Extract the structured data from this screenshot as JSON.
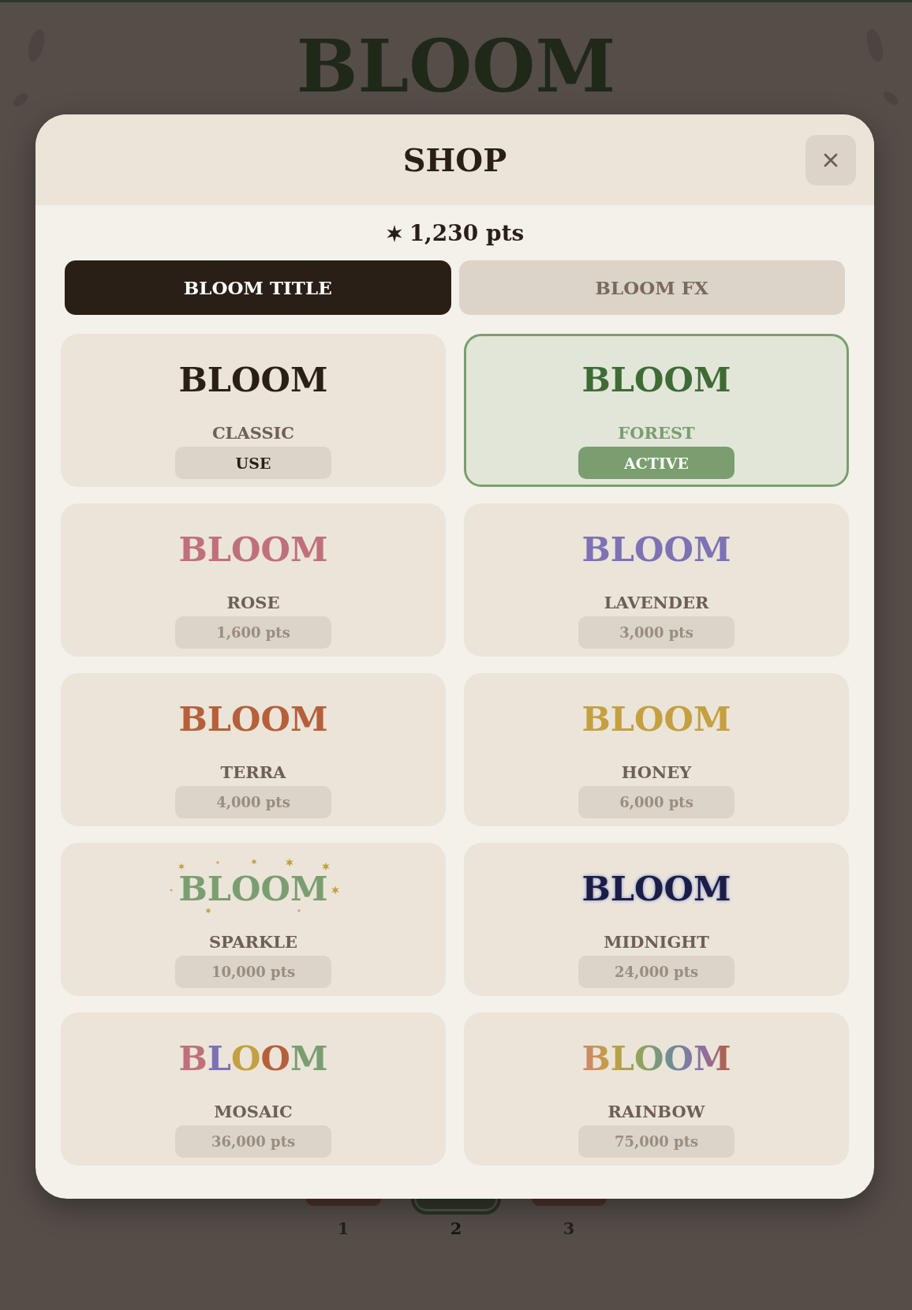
{
  "background": {
    "title": "BLOOM",
    "levels": [
      {
        "label": "1",
        "selected": false
      },
      {
        "label": "2",
        "selected": true
      },
      {
        "label": "3",
        "selected": false
      }
    ]
  },
  "shop": {
    "title": "SHOP",
    "points": "1,230 pts",
    "tabs": [
      {
        "label": "BLOOM TITLE",
        "selected": true
      },
      {
        "label": "BLOOM FX",
        "selected": false
      }
    ],
    "items": [
      {
        "preview": "BLOOM",
        "kind": "solid",
        "color": "#2a1f17",
        "name": "CLASSIC",
        "action": "USE",
        "owned": true,
        "selected": false
      },
      {
        "preview": "BLOOM",
        "kind": "solid",
        "color": "#3f6b35",
        "name": "FOREST",
        "action": "ACTIVE",
        "owned": true,
        "selected": true
      },
      {
        "preview": "BLOOM",
        "kind": "solid",
        "color": "#c0707a",
        "name": "ROSE",
        "action": "1,600 pts",
        "owned": false,
        "selected": false
      },
      {
        "preview": "BLOOM",
        "kind": "solid",
        "color": "#7c72b4",
        "name": "LAVENDER",
        "action": "3,000 pts",
        "owned": false,
        "selected": false
      },
      {
        "preview": "BLOOM",
        "kind": "solid",
        "color": "#b5603a",
        "name": "TERRA",
        "action": "4,000 pts",
        "owned": false,
        "selected": false
      },
      {
        "preview": "BLOOM",
        "kind": "solid",
        "color": "#c4a040",
        "name": "HONEY",
        "action": "6,000 pts",
        "owned": false,
        "selected": false
      },
      {
        "preview": "BLOOM",
        "kind": "sparkle",
        "color": "#7a9e70",
        "name": "SPARKLE",
        "action": "10,000 pts",
        "owned": false,
        "selected": false
      },
      {
        "preview": "BLOOM",
        "kind": "glow",
        "color": "#1b1d45",
        "name": "MIDNIGHT",
        "action": "24,000 pts",
        "owned": false,
        "selected": false
      },
      {
        "preview": "BLOOM",
        "kind": "mosaic",
        "name": "MOSAIC",
        "action": "36,000 pts",
        "owned": false,
        "selected": false
      },
      {
        "preview": "BLOOM",
        "kind": "gradient",
        "name": "RAINBOW",
        "action": "75,000 pts",
        "owned": false,
        "selected": false
      }
    ]
  }
}
